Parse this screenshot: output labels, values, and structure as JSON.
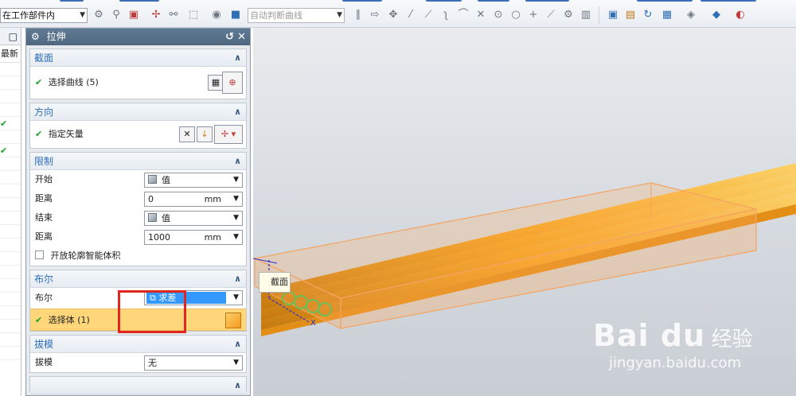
{
  "toolbar": {
    "scope_select": "在工作部件内",
    "curve_rule": "自动判断曲线",
    "colors": {
      "bg": "#eef1f5",
      "accent": "#2f6fb8"
    }
  },
  "navigator": {
    "header_icon": "restore-window-icon",
    "sub_label": "最新"
  },
  "dialog": {
    "title": "拉伸",
    "sections": {
      "section": {
        "title": "截面",
        "select_curve": "选择曲线 (5)"
      },
      "direction": {
        "title": "方向",
        "specify_vector": "指定矢量"
      },
      "limits": {
        "title": "限制",
        "start_label": "开始",
        "start_value": "值",
        "start_distance_label": "距离",
        "start_distance": "0",
        "start_unit": "mm",
        "end_label": "结束",
        "end_value": "值",
        "end_distance_label": "距离",
        "end_distance": "1000",
        "end_unit": "mm",
        "open_profile": "开放轮廓智能体积"
      },
      "boolean": {
        "title": "布尔",
        "label": "布尔",
        "value": "求差",
        "select_body": "选择体 (1)"
      },
      "draft": {
        "title": "拔模",
        "label": "拔模",
        "value": "无"
      }
    }
  },
  "viewport": {
    "tooltip": "截面",
    "axis_label": "X",
    "watermark_logo": "Bai du",
    "watermark_cn": "经验",
    "watermark_url": "jingyan.baidu.com",
    "colors": {
      "rod": "#f5a623",
      "box": "#f4a460",
      "highlight": "#e0261f"
    }
  }
}
